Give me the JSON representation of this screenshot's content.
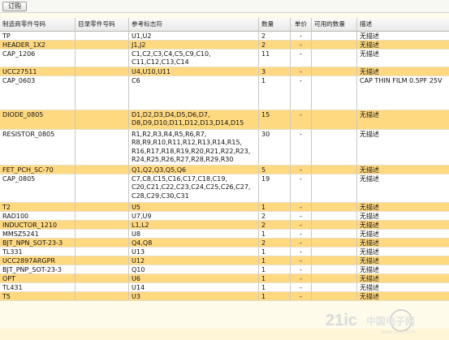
{
  "toolbar": {
    "order_label": "订购"
  },
  "table": {
    "headers": [
      "制造商零件号码",
      "目录零件号码",
      "参考标志符",
      "数量",
      "单价",
      "可用的数量",
      "描述"
    ],
    "rows": [
      {
        "mfr": "TP",
        "cat": "",
        "ref": "U1,U2",
        "qty": "2",
        "price": "-",
        "avail": "",
        "desc": "无描述",
        "color": "white"
      },
      {
        "mfr": "HEADER_1X2",
        "cat": "",
        "ref": "J1,J2",
        "qty": "2",
        "price": "-",
        "avail": "",
        "desc": "无描述",
        "color": "yellow"
      },
      {
        "mfr": "CAP_1206",
        "cat": "",
        "ref": "C1,C2,C3,C4,C5,C9,C10,\nC11,C12,C13,C14",
        "qty": "11",
        "price": "-",
        "avail": "",
        "desc": "无描述",
        "color": "white"
      },
      {
        "mfr": "UCC27511",
        "cat": "",
        "ref": "U4,U10,U11",
        "qty": "3",
        "price": "-",
        "avail": "",
        "desc": "无描述",
        "color": "yellow"
      },
      {
        "mfr": "CAP_0603",
        "cat": "",
        "ref": "C6",
        "qty": "1",
        "price": "-",
        "avail": "",
        "desc": "CAP THIN FILM 0.5PF 25V",
        "color": "white"
      },
      {
        "mfr": "DIODE_0805",
        "cat": "",
        "ref": "D1,D2,D3,D4,D5,D6,D7,\nD8,D9,D10,D11,D12,D13,D14,D15",
        "qty": "15",
        "price": "-",
        "avail": "",
        "desc": "无描述",
        "color": "yellow"
      },
      {
        "mfr": "RESISTOR_0805",
        "cat": "",
        "ref": "R1,R2,R3,R4,R5,R6,R7,\nR8,R9,R10,R11,R12,R13,R14,R15,\nR16,R17,R18,R19,R20,R21,R22,R23,\nR24,R25,R26,R27,R28,R29,R30",
        "qty": "30",
        "price": "-",
        "avail": "",
        "desc": "无描述",
        "color": "white"
      },
      {
        "mfr": "FET_PCH_SC-70",
        "cat": "",
        "ref": "Q1,Q2,Q3,Q5,Q6",
        "qty": "5",
        "price": "-",
        "avail": "",
        "desc": "无描述",
        "color": "yellow"
      },
      {
        "mfr": "CAP_0805",
        "cat": "",
        "ref": "C7,C8,C15,C16,C17,C18,C19,\nC20,C21,C22,C23,C24,C25,C26,C27,\nC28,C29,C30,C31",
        "qty": "19",
        "price": "-",
        "avail": "",
        "desc": "无描述",
        "color": "white"
      },
      {
        "mfr": "T2",
        "cat": "",
        "ref": "U5",
        "qty": "1",
        "price": "-",
        "avail": "",
        "desc": "无描述",
        "color": "yellow"
      },
      {
        "mfr": "RAD100",
        "cat": "",
        "ref": "U7,U9",
        "qty": "2",
        "price": "-",
        "avail": "",
        "desc": "无描述",
        "color": "white"
      },
      {
        "mfr": "INDUCTOR_1210",
        "cat": "",
        "ref": "L1,L2",
        "qty": "2",
        "price": "-",
        "avail": "",
        "desc": "无描述",
        "color": "yellow"
      },
      {
        "mfr": "MMSZ5241",
        "cat": "",
        "ref": "U8",
        "qty": "1",
        "price": "-",
        "avail": "",
        "desc": "无描述",
        "color": "white"
      },
      {
        "mfr": "BJT_NPN_SOT-23-3",
        "cat": "",
        "ref": "Q4,Q8",
        "qty": "2",
        "price": "-",
        "avail": "",
        "desc": "无描述",
        "color": "yellow"
      },
      {
        "mfr": "TL331",
        "cat": "",
        "ref": "U13",
        "qty": "1",
        "price": "-",
        "avail": "",
        "desc": "无描述",
        "color": "white"
      },
      {
        "mfr": "UCC2897ARGPR",
        "cat": "",
        "ref": "U12",
        "qty": "1",
        "price": "-",
        "avail": "",
        "desc": "无描述",
        "color": "yellow"
      },
      {
        "mfr": "BJT_PNP_SOT-23-3",
        "cat": "",
        "ref": "Q10",
        "qty": "1",
        "price": "-",
        "avail": "",
        "desc": "无描述",
        "color": "white"
      },
      {
        "mfr": "OPT",
        "cat": "",
        "ref": "U6",
        "qty": "1",
        "price": "-",
        "avail": "",
        "desc": "无描述",
        "color": "yellow"
      },
      {
        "mfr": "TL431",
        "cat": "",
        "ref": "U14",
        "qty": "1",
        "price": "-",
        "avail": "",
        "desc": "无描述",
        "color": "white"
      },
      {
        "mfr": "T5",
        "cat": "",
        "ref": "U3",
        "qty": "1",
        "price": "-",
        "avail": "",
        "desc": "无描述",
        "color": "yellow"
      }
    ]
  },
  "watermark": {
    "text": "21ic中国电子网",
    "url": "www.21ic.com"
  },
  "colors": {
    "row_white": "#ffffff",
    "row_yellow": "#ffd980",
    "header": "#efefef"
  }
}
